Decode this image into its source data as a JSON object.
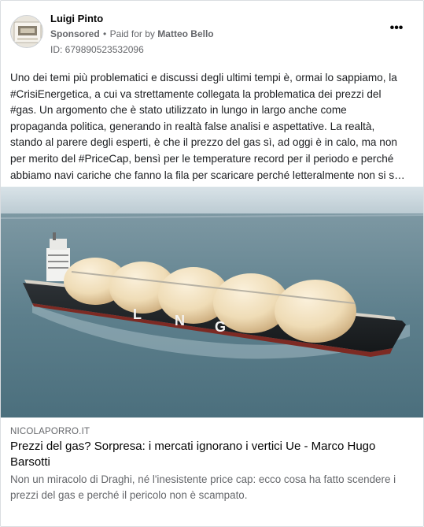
{
  "post": {
    "author": "Luigi Pinto",
    "sponsored_label": "Sponsored",
    "separator": "•",
    "paid_for_prefix": "Paid for by",
    "paid_for_name": "Matteo Bello",
    "ad_id": "ID: 679890523532096",
    "more_icon": "ellipsis-icon",
    "more_label": "•••",
    "text_lines": [
      "Uno dei temi più problematici e discussi degli ultimi tempi è, ormai lo sappiamo, la",
      "#CrisiEnergetica, a cui va strettamente collegata la problematica dei prezzi del",
      "#gas. Un argomento che è stato utilizzato in lungo in largo anche come",
      "propaganda politica, generando in realtà false analisi e aspettative. La realtà,",
      "stando al parere degli esperti, è che il prezzo del gas sì, ad oggi è in calo, ma non",
      "per merito del #PriceCap, bensì per le temperature record per il periodo e perché",
      "abbiamo navi cariche che fanno la fila per scaricare perché letteralmente non si s…"
    ]
  },
  "image": {
    "ship_hull_letters": [
      "L",
      "N",
      "G"
    ]
  },
  "link_preview": {
    "domain": "NICOLAPORRO.IT",
    "headline": "Prezzi del gas? Sorpresa: i mercati ignorano i vertici Ue - Marco Hugo Barsotti",
    "description": "Non un miracolo di Draghi, né l'inesistente price cap: ecco cosa ha fatto scendere i prezzi del gas e perché il pericolo non è scampato."
  },
  "colors": {
    "secondary_text": "#65676b",
    "sea": "#5d7f8c",
    "hull": "#1f2326"
  }
}
